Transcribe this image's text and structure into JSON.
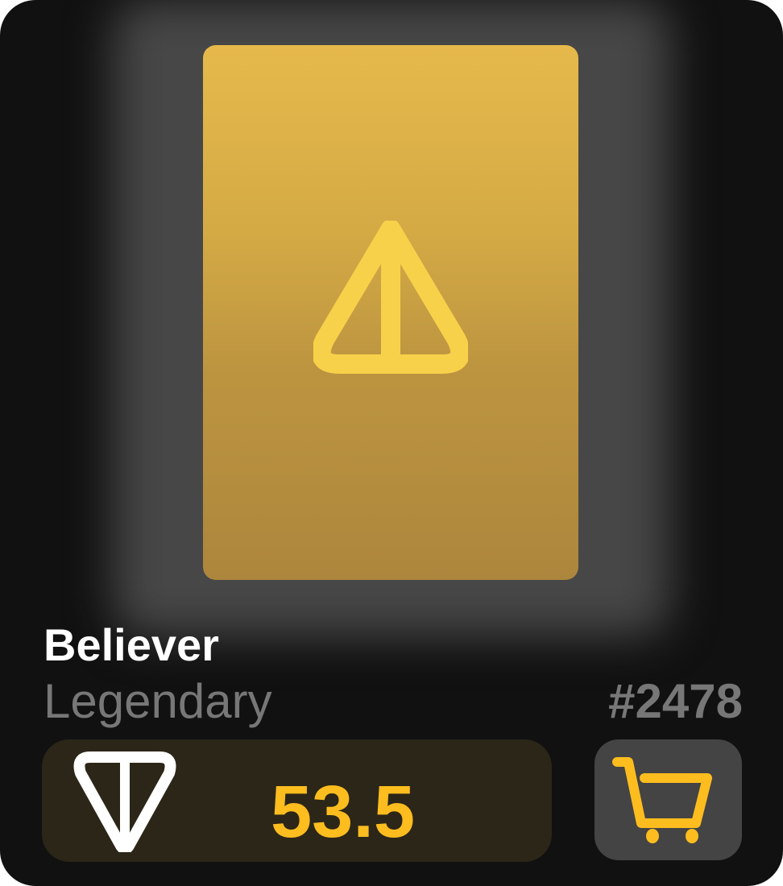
{
  "item": {
    "name": "Believer",
    "rarity": "Legendary",
    "serial": "#2478",
    "price": "53.5",
    "currency_icon": "ton-icon",
    "art_icon": "triangle-logo-icon"
  },
  "actions": {
    "cart_icon": "cart-icon"
  },
  "colors": {
    "accent": "#fdbd1f",
    "card_bg": "#111111",
    "art_top": "#e6b94b",
    "art_bottom": "#ad863d"
  }
}
